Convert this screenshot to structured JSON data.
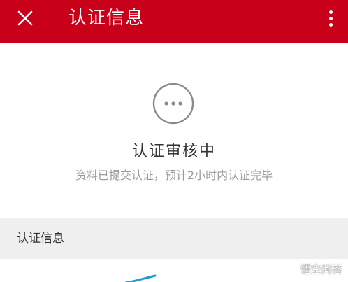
{
  "appbar": {
    "title": "认证信息",
    "close_icon": "close-icon",
    "more_icon": "more-vert-icon",
    "background_color": "#c8001a"
  },
  "status": {
    "icon": "pending-dots-icon",
    "title": "认证审核中",
    "description": "资料已提交认证，预计2小时内认证完毕"
  },
  "section": {
    "header_label": "认证信息"
  },
  "watermark": {
    "text": "悟空问答"
  }
}
